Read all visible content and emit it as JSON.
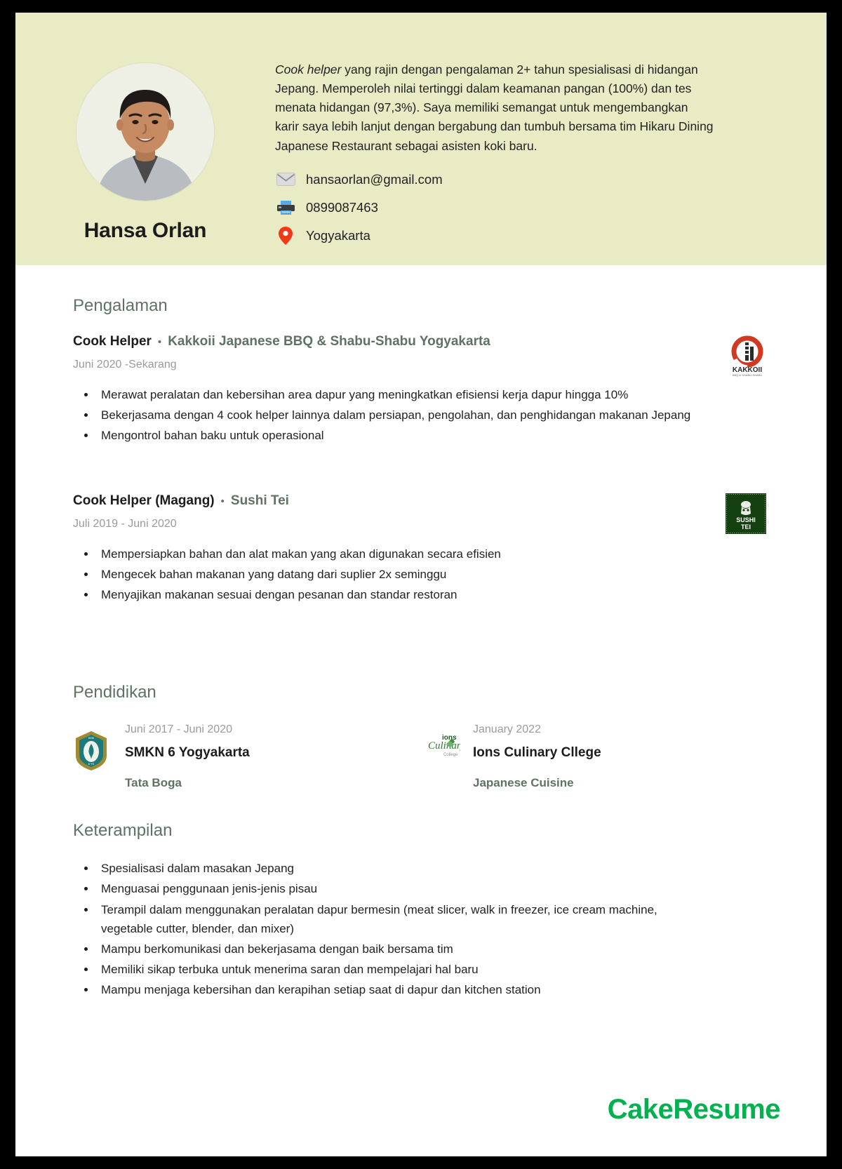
{
  "profile": {
    "name": "Hansa Orlan",
    "avatar_icon": "profile-photo",
    "summary_lead": "Cook helper",
    "summary_rest": " yang rajin dengan pengalaman 2+ tahun spesialisasi di hidangan Jepang. Memperoleh nilai tertinggi dalam keamanan pangan (100%) dan tes menata hidangan (97,3%). Saya memiliki semangat untuk mengembangkan karir saya lebih lanjut dengan bergabung dan tumbuh bersama tim Hikaru Dining Japanese Restaurant sebagai asisten koki baru."
  },
  "contact": [
    {
      "icon": "email-icon",
      "value": "hansaorlan@gmail.com"
    },
    {
      "icon": "fax-icon",
      "value": "0899087463"
    },
    {
      "icon": "location-pin-icon",
      "value": "Yogyakarta"
    }
  ],
  "experience": {
    "section_title": "Pengalaman",
    "jobs": [
      {
        "title": "Cook Helper",
        "separator": "•",
        "company": "Kakkoii Japanese BBQ & Shabu-Shabu Yogyakarta",
        "date": "Juni 2020  -Sekarang",
        "logo_icon": "kakkoii-logo",
        "bullets": [
          "Merawat peralatan dan kebersihan area dapur yang meningkatkan efisiensi kerja dapur hingga 10%",
          "Bekerjasama dengan 4 cook helper lainnya dalam persiapan, pengolahan, dan penghidangan makanan Jepang",
          "Mengontrol bahan baku untuk operasional"
        ]
      },
      {
        "title": "Cook Helper (Magang)",
        "separator": "•",
        "company": "Sushi Tei",
        "date": "Juli 2019 - Juni 2020",
        "logo_icon": "sushi-tei-logo",
        "bullets": [
          "Mempersiapkan bahan dan alat makan yang akan digunakan secara efisien",
          "Mengecek bahan makanan yang datang dari suplier 2x seminggu",
          "Menyajikan makanan sesuai dengan pesanan dan standar restoran"
        ]
      }
    ]
  },
  "education": {
    "section_title": "Pendidikan",
    "items": [
      {
        "date": "Juni 2017 - Juni 2020",
        "school": "SMKN 6 Yogyakarta",
        "major": "Tata Boga",
        "logo_icon": "smkn6-crest-logo"
      },
      {
        "date": "January 2022",
        "school": "Ions Culinary Cllege",
        "major": "Japanese Cuisine",
        "logo_icon": "ions-culinary-logo"
      }
    ]
  },
  "skills": {
    "section_title": "Keterampilan",
    "items": [
      "Spesialisasi dalam masakan Jepang",
      "Menguasai penggunaan jenis-jenis pisau",
      "Terampil dalam menggunakan peralatan dapur bermesin (meat slicer, walk in freezer, ice cream machine, vegetable cutter, blender, dan mixer)",
      "Mampu berkomunikasi dan bekerjasama dengan baik bersama tim",
      "Memiliki sikap terbuka untuk menerima saran dan mempelajari hal baru",
      "Mampu menjaga kebersihan dan kerapihan setiap saat di dapur dan kitchen station"
    ]
  },
  "footer": {
    "brand": "CakeResume",
    "brand_color": "#00b14f"
  },
  "theme": {
    "header_bg": "#e8ebc4",
    "accent_green": "#5f7263",
    "text_dark": "#1c1c1c",
    "text_muted": "#9a9a9a"
  }
}
